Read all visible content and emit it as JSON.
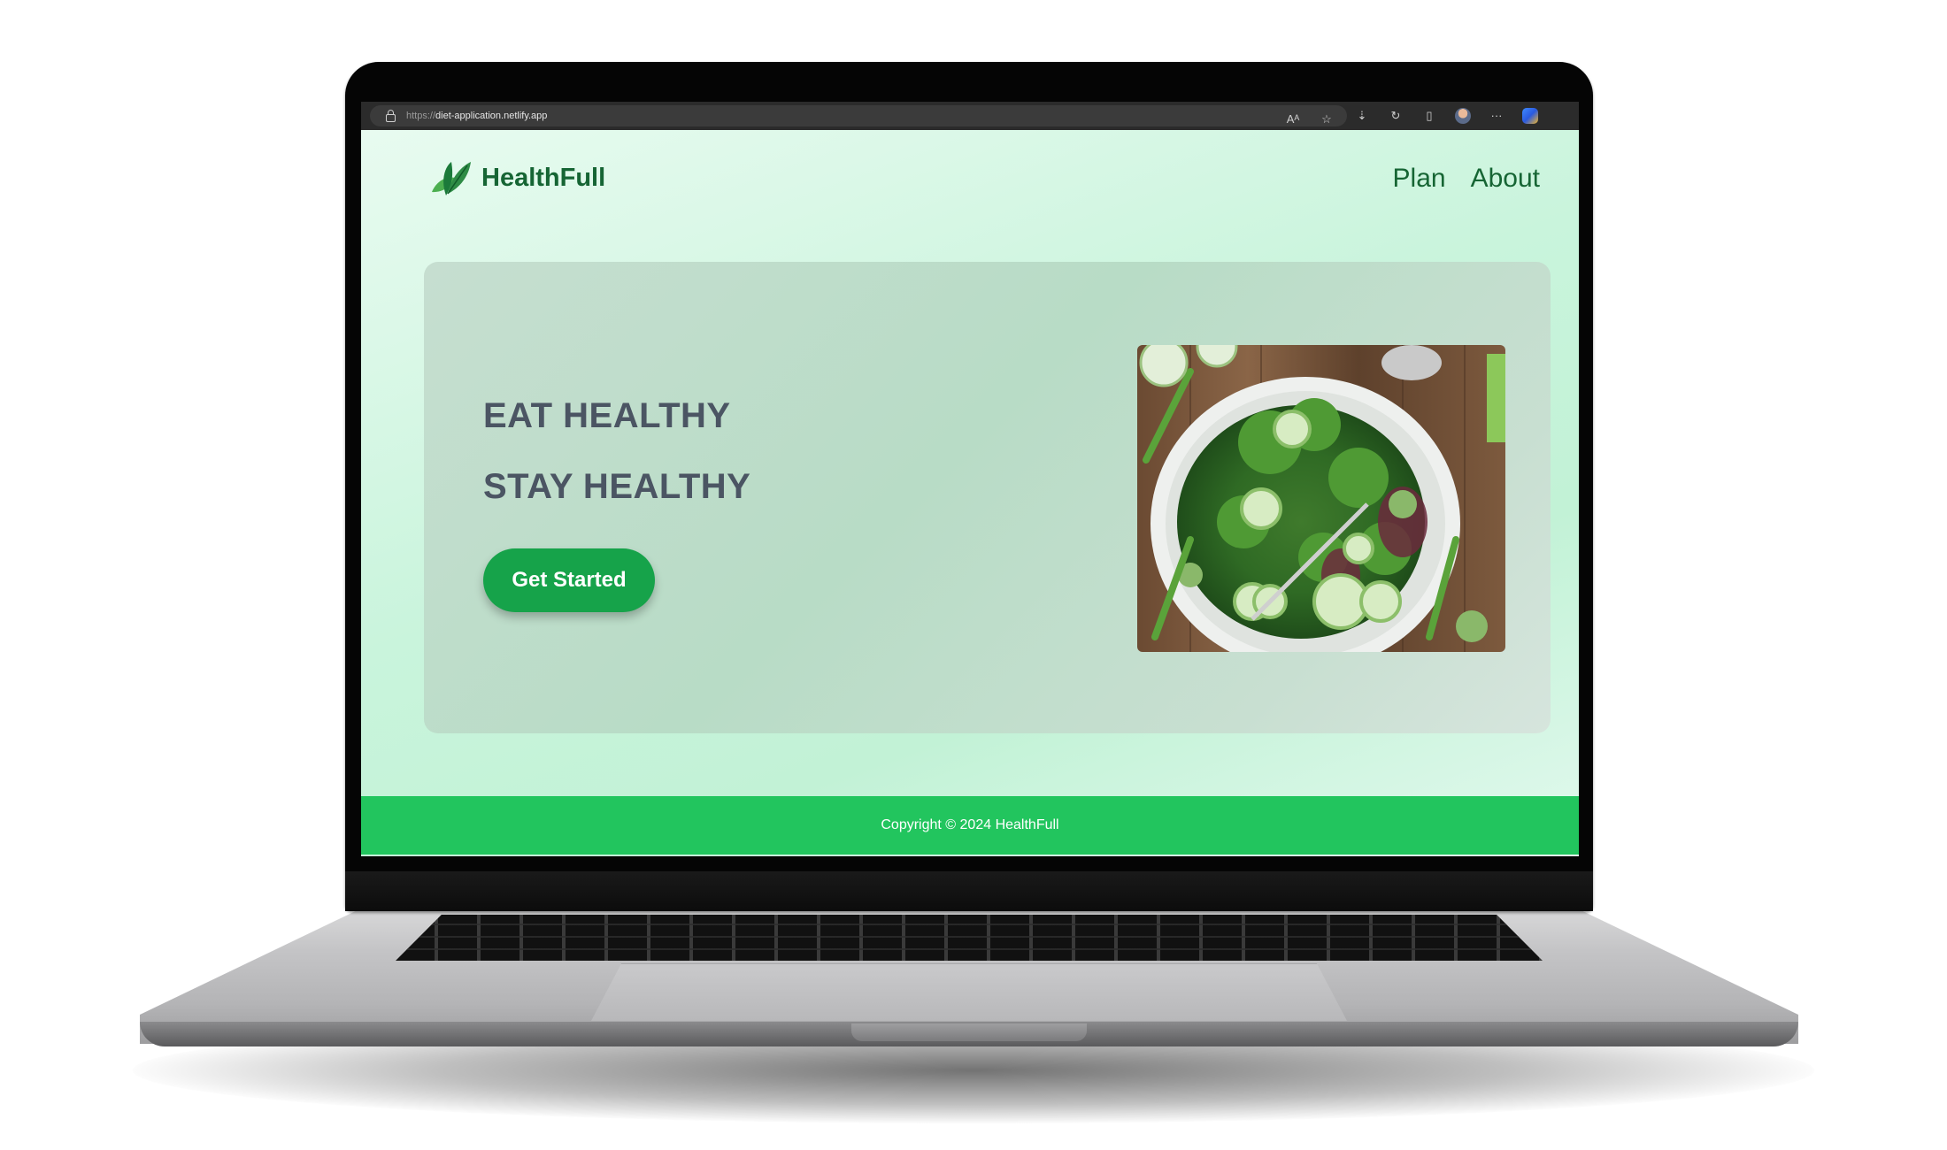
{
  "browser": {
    "url_scheme": "https://",
    "url_host": "diet-application.netlify.app",
    "icons": [
      "lock-icon",
      "read-aloud-icon",
      "favorite-star-icon",
      "extensions-icon",
      "refresh-icon",
      "split-screen-icon",
      "profile-avatar-icon",
      "more-options-icon",
      "copilot-icon"
    ],
    "read_aloud_glyph": "Aᴬ",
    "more_glyph": "···"
  },
  "site": {
    "brand": "HealthFull",
    "nav": [
      {
        "label": "Plan"
      },
      {
        "label": "About"
      }
    ],
    "hero": {
      "line1": "EAT HEALTHY",
      "line2": "STAY HEALTHY",
      "cta": "Get Started"
    },
    "footer": "Copyright © 2024 HealthFull"
  },
  "colors": {
    "brand_green": "#166534",
    "button_green": "#16a34a",
    "footer_green": "#22c55e",
    "headline_gray": "#4b5563"
  }
}
